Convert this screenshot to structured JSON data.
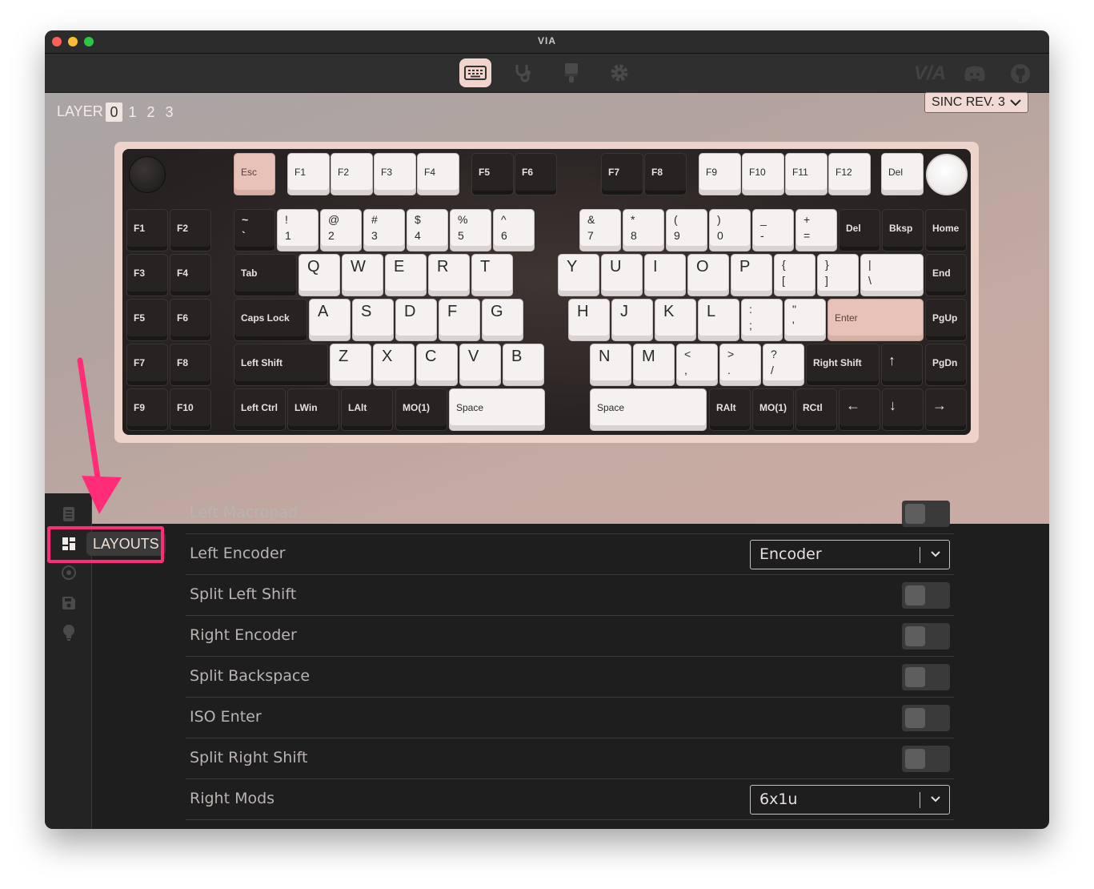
{
  "window": {
    "title": "VIA"
  },
  "toolbar": {
    "tabs": [
      {
        "icon": "keyboard-icon"
      },
      {
        "icon": "stethoscope-icon"
      },
      {
        "icon": "paintbrush-icon"
      },
      {
        "icon": "gear-icon"
      }
    ],
    "logo_text": "V/A",
    "right_icons": [
      "discord-icon",
      "github-icon"
    ]
  },
  "layers": {
    "label": "LAYER",
    "items": [
      "0",
      "1",
      "2",
      "3"
    ],
    "selected": "0"
  },
  "keyboard_select": {
    "value": "SINC REV. 3"
  },
  "keys": {
    "esc": "Esc",
    "f1": "F1",
    "f2": "F2",
    "f3": "F3",
    "f4": "F4",
    "f5": "F5",
    "f6": "F6",
    "f7": "F7",
    "f8": "F8",
    "f9": "F9",
    "f10": "F10",
    "f11": "F11",
    "f12": "F12",
    "del": "Del",
    "m1": "F1",
    "m2": "F2",
    "m3": "F3",
    "m4": "F4",
    "m5": "F5",
    "m6": "F6",
    "m7": "F7",
    "m8": "F8",
    "m9": "F9",
    "m10": "F10",
    "tilde": "~\n`",
    "k1": "!\n1",
    "k2": "@\n2",
    "k3": "#\n3",
    "k4": "$\n4",
    "k5": "%\n5",
    "k6": "^\n6",
    "k7": "&\n7",
    "k8": "*\n8",
    "k9": "(\n9",
    "k0": ")\n0",
    "minus": "_\n-",
    "plus": "+\n=",
    "del2": "Del",
    "bksp": "Bksp",
    "home": "Home",
    "tab": "Tab",
    "q": "Q",
    "w": "W",
    "e": "E",
    "r": "R",
    "t": "T",
    "y": "Y",
    "u": "U",
    "i": "I",
    "o": "O",
    "p": "P",
    "lbr": "{\n[",
    "rbr": "}\n]",
    "bsl": "|\n\\",
    "end": "End",
    "caps": "Caps Lock",
    "a": "A",
    "s": "S",
    "d": "D",
    "f": "F",
    "g": "G",
    "h": "H",
    "j": "J",
    "k": "K",
    "l": "L",
    "semi": ":\n;",
    "quote": "\"\n'",
    "enter": "Enter",
    "pgup": "PgUp",
    "lshift": "Left Shift",
    "z": "Z",
    "x": "X",
    "c": "C",
    "v": "V",
    "b": "B",
    "n": "N",
    "m": "M",
    "comma": "<\n,",
    "period": ">\n.",
    "slash": "?\n/",
    "rshift": "Right Shift",
    "up": "↑",
    "pgdn": "PgDn",
    "lctrl": "Left Ctrl",
    "lwin": "LWin",
    "lalt": "LAlt",
    "mo1": "MO(1)",
    "space1": "Space",
    "space2": "Space",
    "ralt": "RAlt",
    "mo2": "MO(1)",
    "rctl": "RCtl",
    "left": "←",
    "down": "↓",
    "right": "→"
  },
  "sidebar": {
    "items": [
      "book-icon",
      "layouts-icon",
      "macro-icon",
      "save-icon",
      "lightbulb-icon"
    ],
    "tooltip": "LAYOUTS"
  },
  "layout_options": [
    {
      "label": "Left Macropad",
      "type": "toggle",
      "on": false
    },
    {
      "label": "Left Encoder",
      "type": "select",
      "value": "Encoder"
    },
    {
      "label": "Split Left Shift",
      "type": "toggle",
      "on": false
    },
    {
      "label": "Right Encoder",
      "type": "toggle",
      "on": false
    },
    {
      "label": "Split Backspace",
      "type": "toggle",
      "on": false
    },
    {
      "label": "ISO Enter",
      "type": "toggle",
      "on": false
    },
    {
      "label": "Split Right Shift",
      "type": "toggle",
      "on": false
    },
    {
      "label": "Right Mods",
      "type": "select",
      "value": "6x1u"
    }
  ],
  "colors": {
    "accent": "#f1d5cc",
    "annotation": "#ff2d78",
    "frame": "#eed3cb"
  }
}
